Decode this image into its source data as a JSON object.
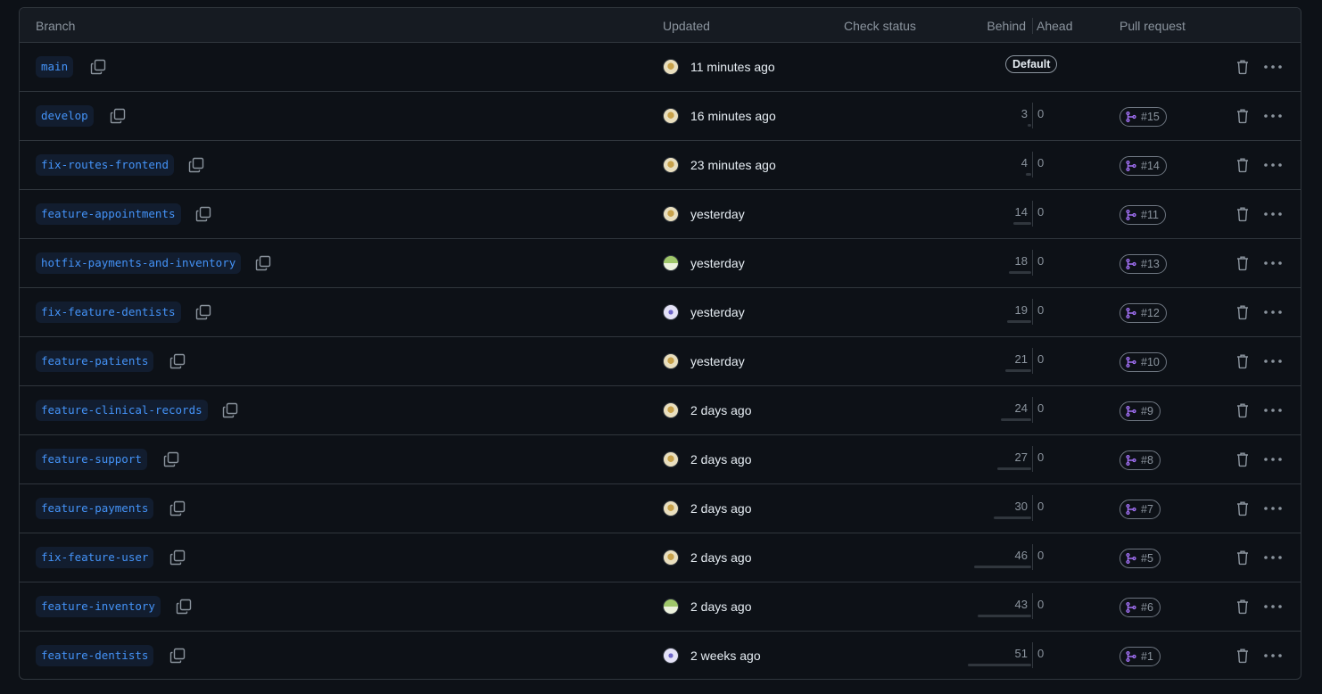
{
  "header": {
    "branch": "Branch",
    "updated": "Updated",
    "check_status": "Check status",
    "behind": "Behind",
    "ahead": "Ahead",
    "pull_request": "Pull request"
  },
  "colors": {
    "background": "#0d1117",
    "border": "#30363d",
    "branch_link": "#4493f8",
    "pr_icon": "#a371f7"
  },
  "rows": [
    {
      "branch": "main",
      "updated": "11 minutes ago",
      "avatar": "a1",
      "default_label": "Default",
      "behind": "",
      "ahead": "",
      "pr": ""
    },
    {
      "branch": "develop",
      "updated": "16 minutes ago",
      "avatar": "a1",
      "behind": "3",
      "ahead": "0",
      "pr": "#15"
    },
    {
      "branch": "fix-routes-frontend",
      "updated": "23 minutes ago",
      "avatar": "a1",
      "behind": "4",
      "ahead": "0",
      "pr": "#14"
    },
    {
      "branch": "feature-appointments",
      "updated": "yesterday",
      "avatar": "a1",
      "behind": "14",
      "ahead": "0",
      "pr": "#11"
    },
    {
      "branch": "hotfix-payments-and-inventory",
      "updated": "yesterday",
      "avatar": "a2",
      "behind": "18",
      "ahead": "0",
      "pr": "#13"
    },
    {
      "branch": "fix-feature-dentists",
      "updated": "yesterday",
      "avatar": "a3",
      "behind": "19",
      "ahead": "0",
      "pr": "#12"
    },
    {
      "branch": "feature-patients",
      "updated": "yesterday",
      "avatar": "a1",
      "behind": "21",
      "ahead": "0",
      "pr": "#10"
    },
    {
      "branch": "feature-clinical-records",
      "updated": "2 days ago",
      "avatar": "a1",
      "behind": "24",
      "ahead": "0",
      "pr": "#9"
    },
    {
      "branch": "feature-support",
      "updated": "2 days ago",
      "avatar": "a1",
      "behind": "27",
      "ahead": "0",
      "pr": "#8"
    },
    {
      "branch": "feature-payments",
      "updated": "2 days ago",
      "avatar": "a1",
      "behind": "30",
      "ahead": "0",
      "pr": "#7"
    },
    {
      "branch": "fix-feature-user",
      "updated": "2 days ago",
      "avatar": "a1",
      "behind": "46",
      "ahead": "0",
      "pr": "#5"
    },
    {
      "branch": "feature-inventory",
      "updated": "2 days ago",
      "avatar": "a2",
      "behind": "43",
      "ahead": "0",
      "pr": "#6"
    },
    {
      "branch": "feature-dentists",
      "updated": "2 weeks ago",
      "avatar": "a3",
      "behind": "51",
      "ahead": "0",
      "pr": "#1"
    }
  ]
}
